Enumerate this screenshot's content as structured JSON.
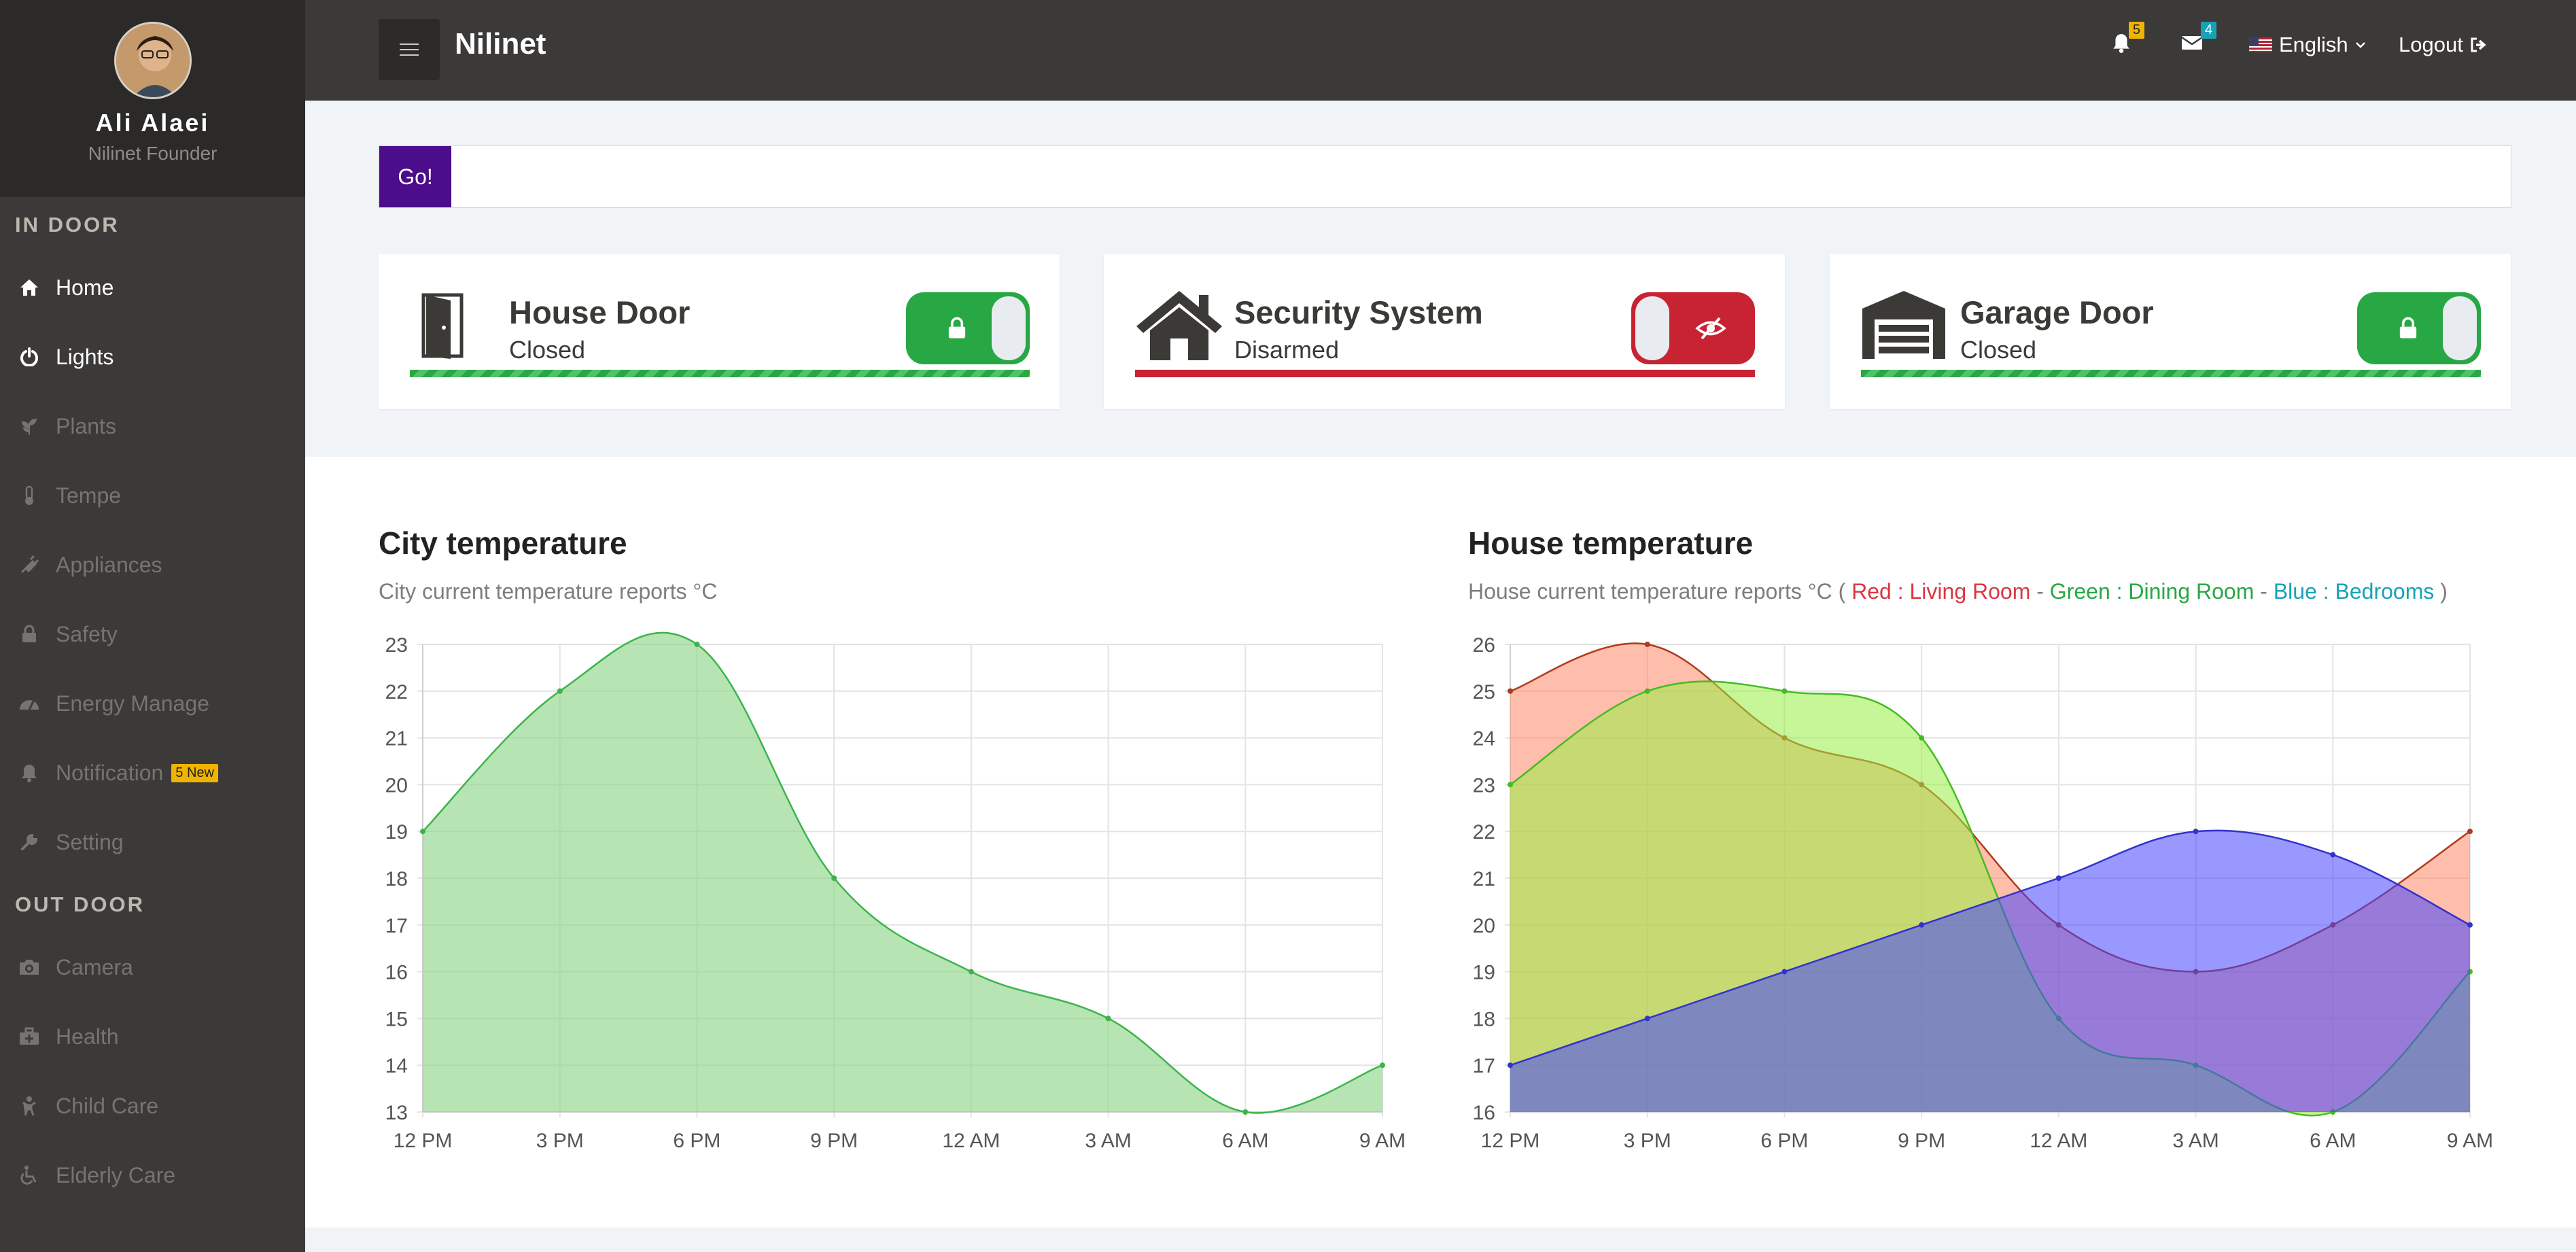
{
  "profile": {
    "name": "Ali Alaei",
    "role": "Nilinet Founder"
  },
  "sidebar": {
    "indoor_title": "IN DOOR",
    "indoor": [
      {
        "label": "Home",
        "icon": "home-icon",
        "active": true
      },
      {
        "label": "Lights",
        "icon": "power-icon",
        "active": true
      },
      {
        "label": "Plants",
        "icon": "plant-icon"
      },
      {
        "label": "Tempe",
        "icon": "thermometer-icon"
      },
      {
        "label": "Appliances",
        "icon": "plug-icon"
      },
      {
        "label": "Safety",
        "icon": "lock-icon"
      },
      {
        "label": "Energy Manage",
        "icon": "gauge-icon"
      },
      {
        "label": "Notification",
        "icon": "bell-icon",
        "badge": "5 New"
      },
      {
        "label": "Setting",
        "icon": "wrench-icon"
      }
    ],
    "outdoor_title": "OUT DOOR",
    "outdoor": [
      {
        "label": "Camera",
        "icon": "camera-icon"
      },
      {
        "label": "Health",
        "icon": "medkit-icon"
      },
      {
        "label": "Child Care",
        "icon": "child-icon"
      },
      {
        "label": "Elderly Care",
        "icon": "wheelchair-icon"
      }
    ]
  },
  "topbar": {
    "brand": "Nilinet",
    "notif_count": "5",
    "mail_count": "4",
    "language": "English",
    "logout": "Logout",
    "colors": {
      "notif_badge": "#f0b400",
      "mail_badge": "#17a2b8"
    }
  },
  "search": {
    "go_label": "Go!",
    "placeholder": ""
  },
  "cards": [
    {
      "title": "House Door",
      "status": "Closed",
      "icon": "door-icon",
      "toggle": "lock-icon",
      "state_color": "#28a745"
    },
    {
      "title": "Security System",
      "status": "Disarmed",
      "icon": "house-icon",
      "toggle": "eye-slash-icon",
      "state_color": "#c82333"
    },
    {
      "title": "Garage Door",
      "status": "Closed",
      "icon": "garage-icon",
      "toggle": "lock-icon",
      "state_color": "#28a745"
    }
  ],
  "city_chart": {
    "title": "City temperature",
    "subtitle": "City current temperature reports °C"
  },
  "house_chart": {
    "title": "House temperature",
    "subtitle_prefix": "House current temperature reports °C (",
    "legend": [
      {
        "text": "Red : Living Room",
        "color": "#dc3545"
      },
      {
        "text": " - ",
        "color": "#7d7d7d"
      },
      {
        "text": "Green : Dining Room",
        "color": "#28a745"
      },
      {
        "text": " - ",
        "color": "#7d7d7d"
      },
      {
        "text": "Blue : Bedrooms",
        "color": "#17a2b8"
      }
    ],
    "subtitle_suffix": ")"
  },
  "chart_data": [
    {
      "type": "area",
      "title": "City temperature",
      "categories": [
        "12 PM",
        "3 PM",
        "6 PM",
        "9 PM",
        "12 AM",
        "3 AM",
        "6 AM",
        "9 AM"
      ],
      "series": [
        {
          "values": [
            19,
            22,
            23,
            18,
            16,
            15,
            13,
            14
          ],
          "color": "#8fd68a"
        }
      ],
      "ylim": [
        13,
        23
      ],
      "yticks": [
        13,
        14,
        15,
        16,
        17,
        18,
        19,
        20,
        21,
        22,
        23
      ],
      "grid": true
    },
    {
      "type": "area",
      "title": "House temperature",
      "categories": [
        "12 PM",
        "3 PM",
        "6 PM",
        "9 PM",
        "12 AM",
        "3 AM",
        "6 AM",
        "9 AM"
      ],
      "series": [
        {
          "name": "Living Room",
          "values": [
            25,
            26,
            24,
            23,
            20,
            19,
            20,
            22
          ],
          "color": "#ff8866"
        },
        {
          "name": "Dining Room",
          "values": [
            23,
            25,
            25,
            24,
            18,
            17,
            16,
            19
          ],
          "color": "#99ee44"
        },
        {
          "name": "Bedrooms",
          "values": [
            17,
            18,
            19,
            20,
            21,
            22,
            21.5,
            20
          ],
          "color": "#4444ff"
        }
      ],
      "ylim": [
        16,
        26
      ],
      "yticks": [
        16,
        17,
        18,
        19,
        20,
        21,
        22,
        23,
        24,
        25,
        26
      ],
      "grid": true
    }
  ]
}
